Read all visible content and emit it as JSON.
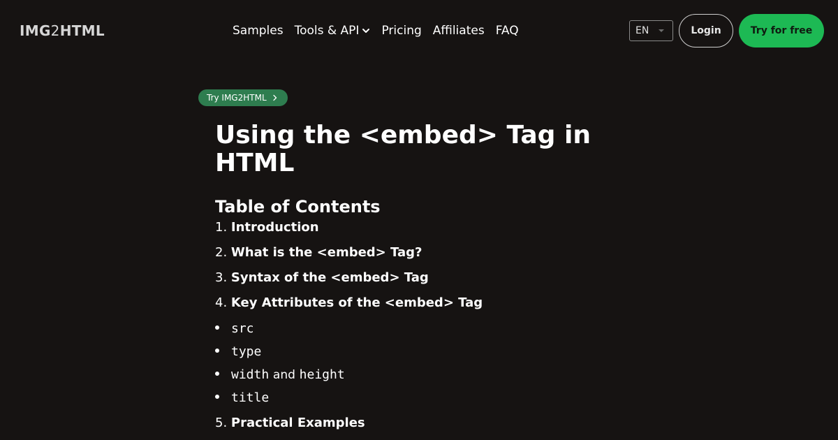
{
  "header": {
    "logo": {
      "part1": "IMG",
      "part2": "2",
      "part3": "HTML"
    },
    "nav": [
      {
        "label": "Samples"
      },
      {
        "label": "Tools & API",
        "has_dropdown": true
      },
      {
        "label": "Pricing"
      },
      {
        "label": "Affiliates"
      },
      {
        "label": "FAQ"
      }
    ],
    "language": "EN",
    "login_label": "Login",
    "try_label": "Try for free"
  },
  "badge": {
    "label": "Try IMG2HTML"
  },
  "article": {
    "title": "Using the <embed> Tag in HTML",
    "toc_heading": "Table of Contents",
    "toc": [
      {
        "num": "1.",
        "label": "Introduction"
      },
      {
        "num": "2.",
        "label": "What is the <embed> Tag?"
      },
      {
        "num": "3.",
        "label": "Syntax of the <embed> Tag"
      },
      {
        "num": "4.",
        "label": "Key Attributes of the <embed> Tag"
      },
      {
        "num": "5.",
        "label": "Practical Examples"
      }
    ],
    "attributes": [
      {
        "code": "src"
      },
      {
        "code": "type"
      },
      {
        "code": "width",
        "joiner": "and",
        "code2": "height"
      },
      {
        "code": "title"
      }
    ]
  },
  "colors": {
    "background": "#161312",
    "accent_green": "#1db954",
    "badge_green": "#2e7d4f",
    "text": "#ffffff"
  },
  "icons": {
    "nav_dropdown": "chevron-down-icon",
    "badge_arrow": "chevron-right-icon",
    "lang_caret": "caret-down-icon"
  }
}
